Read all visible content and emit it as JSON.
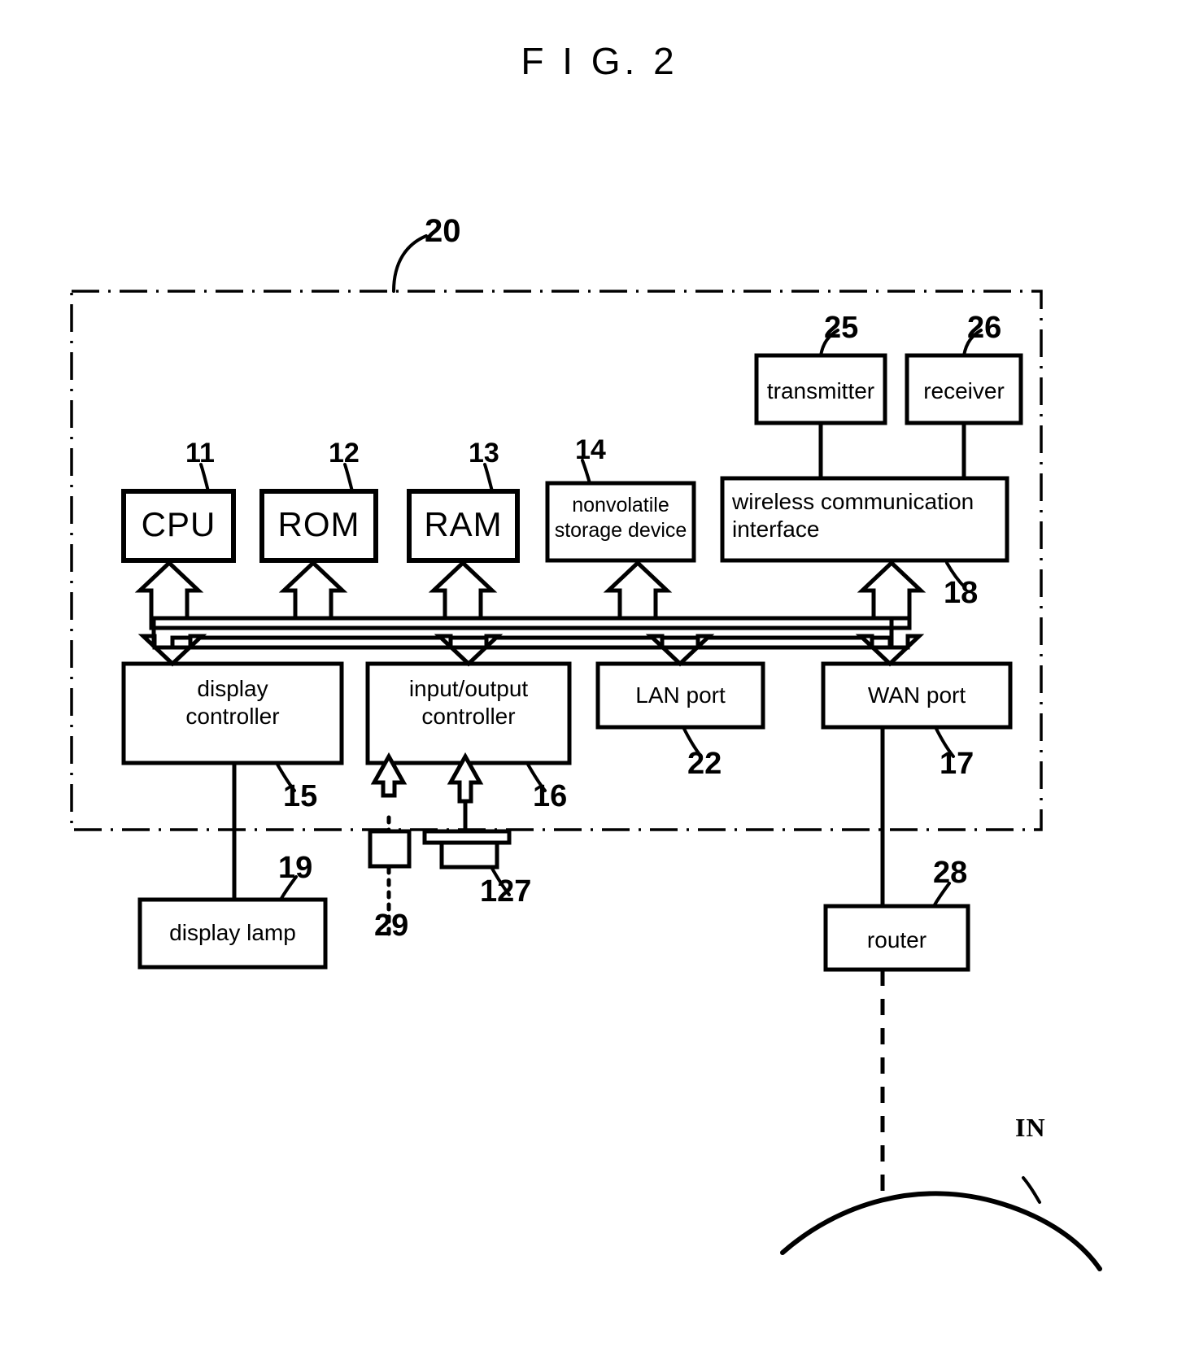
{
  "figure": {
    "title": "F I G. 2"
  },
  "device_boundary": {
    "ref": "20"
  },
  "blocks": {
    "cpu": {
      "label": "CPU",
      "ref": "11"
    },
    "rom": {
      "label": "ROM",
      "ref": "12"
    },
    "ram": {
      "label": "RAM",
      "ref": "13"
    },
    "nonvolatile": {
      "label": "nonvolatile\nstorage device",
      "ref": "14"
    },
    "transmitter": {
      "label": "transmitter",
      "ref": "25"
    },
    "receiver": {
      "label": "receiver",
      "ref": "26"
    },
    "wireless": {
      "label": "wireless communication\ninterface",
      "ref": "18"
    },
    "display_controller": {
      "label": "display\ncontroller",
      "ref": "15"
    },
    "io_controller": {
      "label": "input/output\ncontroller",
      "ref": "16"
    },
    "lan_port": {
      "label": "LAN port",
      "ref": "22"
    },
    "wan_port": {
      "label": "WAN port",
      "ref": "17"
    },
    "display_lamp": {
      "label": "display lamp",
      "ref": "19"
    },
    "router": {
      "label": "router",
      "ref": "28"
    }
  },
  "peripherals": {
    "sensor_29": {
      "ref": "29"
    },
    "device_127": {
      "ref": "127"
    }
  },
  "network": {
    "internet_label": "IN"
  },
  "colors": {
    "stroke": "#000000",
    "background": "#ffffff"
  }
}
